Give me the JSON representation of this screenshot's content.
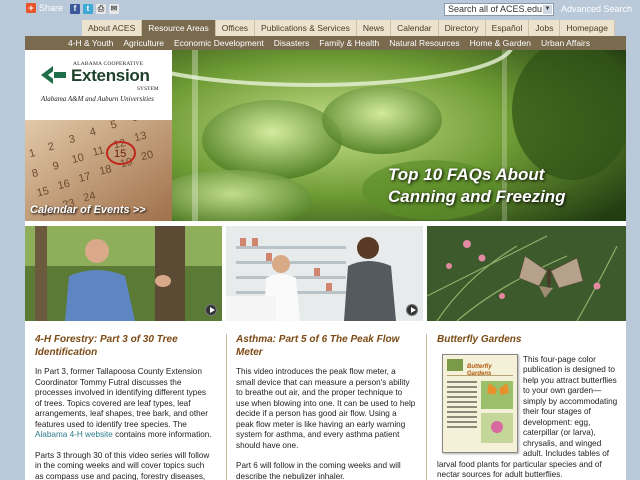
{
  "topbar": {
    "share_label": "Share",
    "search_value": "Search all of ACES.edu",
    "advanced_search": "Advanced Search"
  },
  "nav_primary": [
    "About ACES",
    "Resource Areas",
    "Offices",
    "Publications & Services",
    "News",
    "Calendar",
    "Directory",
    "Español",
    "Jobs",
    "Homepage"
  ],
  "nav_secondary": [
    "4-H & Youth",
    "Agriculture",
    "Economic Development",
    "Disasters",
    "Family & Health",
    "Natural Resources",
    "Home & Garden",
    "Urban Affairs"
  ],
  "logo": {
    "top": "ALABAMA COOPERATIVE",
    "main": "Extension",
    "system": "SYSTEM",
    "sub": "Alabama A&M and Auburn Universities"
  },
  "calendar": {
    "label": "Calendar of Events >>"
  },
  "hero": {
    "line1": "Top 10 FAQs About",
    "line2": "Canning and Freezing"
  },
  "articles": [
    {
      "title": "4-H Forestry: Part 3 of 30 Tree Identification",
      "p1": "In Part 3, former Tallapoosa County Extension Coordinator Tommy Futral discusses the processes involved in identifying different types of trees. Topics covered are leaf types, leaf arrangements, leaf shapes, tree bark, and other features used to identify tree species. The",
      "link": "Alabama 4-H website",
      "p1_end": "contains more information.",
      "p2": "Parts 3 through 30 of this video series will follow in the coming weeks and will cover topics such as compass use and pacing, forestry diseases,"
    },
    {
      "title": "Asthma: Part 5 of 6 The Peak Flow Meter",
      "p1": "This video introduces the peak flow meter, a small device that can measure a person's ability to breathe out air, and the proper technique to use when blowing into one. It can be used to help decide if a person has good air flow. Using a peak flow meter is like having an early warning system for asthma, and every asthma patient should have one.",
      "p2": "Part 6 will follow in the coming weeks and will describe the nebulizer inhaler."
    },
    {
      "title": "Butterfly Gardens",
      "p1": "This four-page color publication is designed to help you attract butterflies to your own garden—simply by accommodating their four stages of development: egg, caterpillar (or larva), chrysalis, and winged adult. Includes tables of larval food plants for particular species and of nectar sources for adult butterflies.",
      "brochure_title": "Butterfly Gardens"
    }
  ],
  "colors": {
    "nav_active": "#7a6a4e",
    "nav_bg": "#ece3cf",
    "heading": "#7b4a14",
    "link": "#2a7b8b",
    "page_bg": "#b9c9da"
  }
}
